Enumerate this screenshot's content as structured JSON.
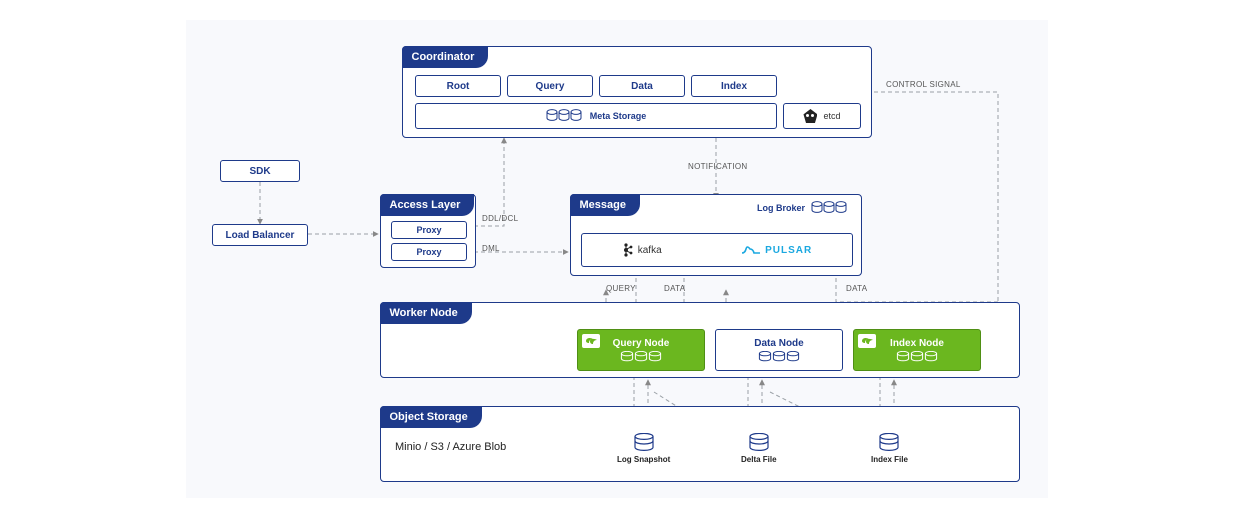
{
  "left": {
    "sdk": "SDK",
    "lb": "Load Balancer"
  },
  "coordinator": {
    "title": "Coordinator",
    "root": "Root",
    "query": "Query",
    "data": "Data",
    "index": "Index",
    "meta": "Meta Storage",
    "etcd": "etcd"
  },
  "access": {
    "title": "Access Layer",
    "proxy": "Proxy"
  },
  "message": {
    "title": "Message",
    "logbroker": "Log Broker",
    "kafka": "kafka",
    "pulsar": "PULSAR"
  },
  "worker": {
    "title": "Worker Node",
    "query": "Query Node",
    "data": "Data Node",
    "index": "Index Node"
  },
  "storage": {
    "title": "Object Storage",
    "providers": "Minio / S3 / Azure Blob",
    "log": "Log Snapshot",
    "delta": "Delta File",
    "indexf": "Index File"
  },
  "edges": {
    "ddl": "DDL/DCL",
    "dml": "DML",
    "notification": "NOTIFICATION",
    "control": "CONTROL SIGNAL",
    "query": "QUERY",
    "data": "DATA"
  }
}
